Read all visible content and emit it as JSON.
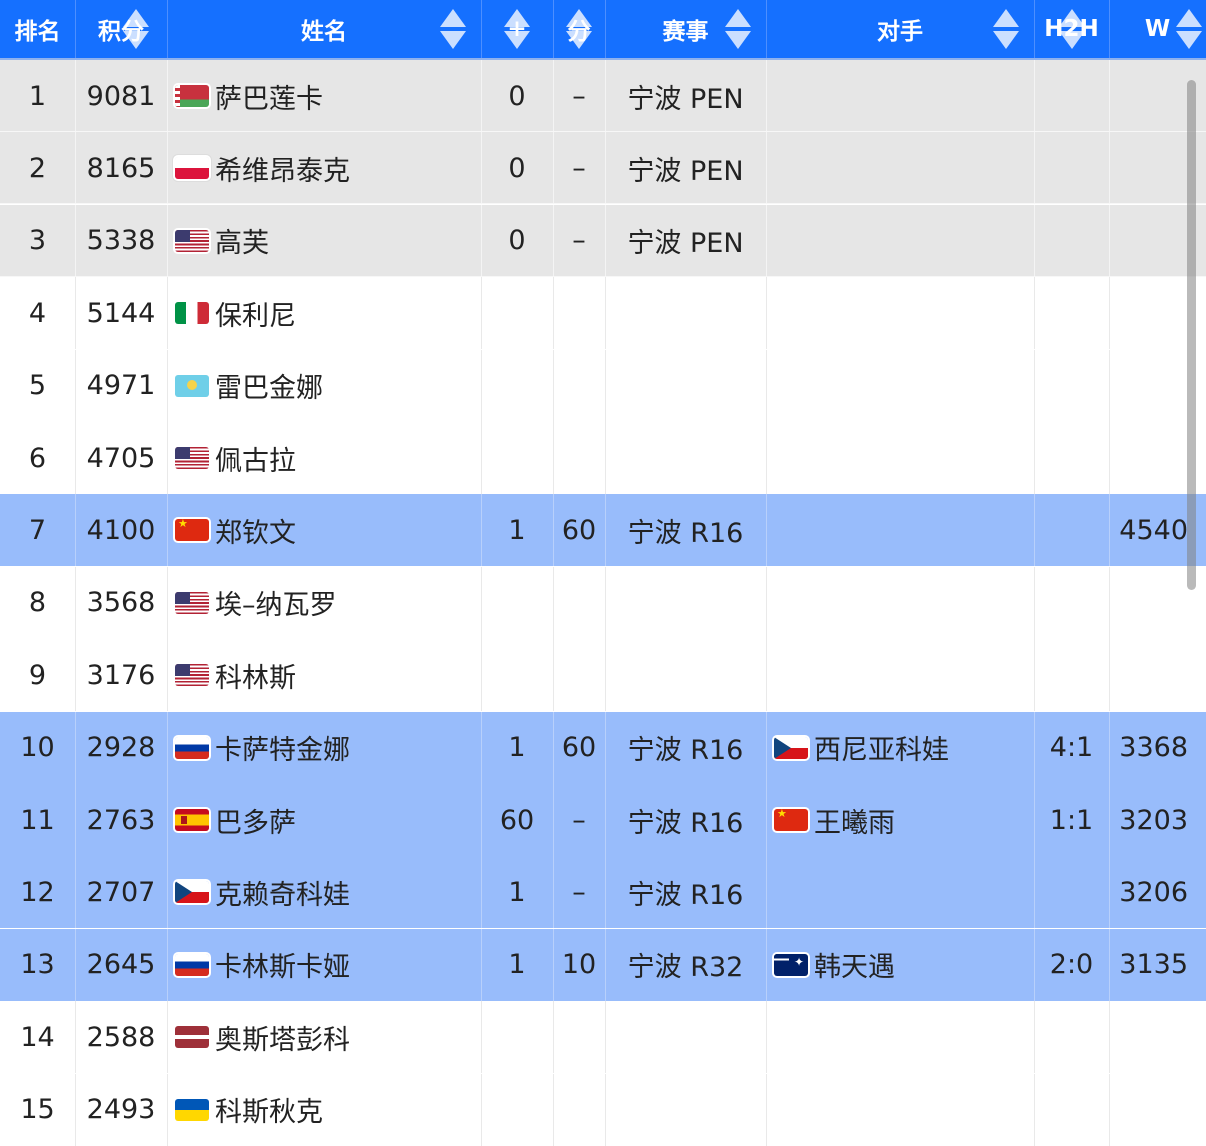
{
  "header": {
    "columns": [
      "排名",
      "积分",
      "姓名",
      "+",
      "分",
      "赛事",
      "对手",
      "H2H",
      "W"
    ]
  },
  "rows": [
    {
      "rank": "1",
      "points": "9081",
      "flag": "by",
      "name": "萨巴莲卡",
      "plus": "0",
      "score": "–",
      "event": "宁波 PEN",
      "opp_flag": "",
      "opponent": "",
      "h2h": "",
      "w": "",
      "style": "gray"
    },
    {
      "rank": "2",
      "points": "8165",
      "flag": "pl",
      "name": "希维昂泰克",
      "plus": "0",
      "score": "–",
      "event": "宁波 PEN",
      "opp_flag": "",
      "opponent": "",
      "h2h": "",
      "w": "",
      "style": "gray"
    },
    {
      "rank": "3",
      "points": "5338",
      "flag": "us",
      "name": "高芙",
      "plus": "0",
      "score": "–",
      "event": "宁波 PEN",
      "opp_flag": "",
      "opponent": "",
      "h2h": "",
      "w": "",
      "style": "gray"
    },
    {
      "rank": "4",
      "points": "5144",
      "flag": "it",
      "name": "保利尼",
      "plus": "",
      "score": "",
      "event": "",
      "opp_flag": "",
      "opponent": "",
      "h2h": "",
      "w": "",
      "style": "white"
    },
    {
      "rank": "5",
      "points": "4971",
      "flag": "kz",
      "name": "雷巴金娜",
      "plus": "",
      "score": "",
      "event": "",
      "opp_flag": "",
      "opponent": "",
      "h2h": "",
      "w": "",
      "style": "white"
    },
    {
      "rank": "6",
      "points": "4705",
      "flag": "us",
      "name": "佩古拉",
      "plus": "",
      "score": "",
      "event": "",
      "opp_flag": "",
      "opponent": "",
      "h2h": "",
      "w": "",
      "style": "white"
    },
    {
      "rank": "7",
      "points": "4100",
      "flag": "cn",
      "name": "郑钦文",
      "plus": "1",
      "score": "60",
      "event": "宁波 R16",
      "opp_flag": "",
      "opponent": "",
      "h2h": "",
      "w": "4540",
      "style": "blue"
    },
    {
      "rank": "8",
      "points": "3568",
      "flag": "us",
      "name": "埃–纳瓦罗",
      "plus": "",
      "score": "",
      "event": "",
      "opp_flag": "",
      "opponent": "",
      "h2h": "",
      "w": "",
      "style": "white"
    },
    {
      "rank": "9",
      "points": "3176",
      "flag": "us",
      "name": "科林斯",
      "plus": "",
      "score": "",
      "event": "",
      "opp_flag": "",
      "opponent": "",
      "h2h": "",
      "w": "",
      "style": "white"
    },
    {
      "rank": "10",
      "points": "2928",
      "flag": "ru",
      "name": "卡萨特金娜",
      "plus": "1",
      "score": "60",
      "event": "宁波 R16",
      "opp_flag": "cz",
      "opponent": "西尼亚科娃",
      "h2h": "4:1",
      "w": "3368",
      "style": "blue"
    },
    {
      "rank": "11",
      "points": "2763",
      "flag": "es",
      "name": "巴多萨",
      "plus": "60",
      "score": "–",
      "event": "宁波 R16",
      "opp_flag": "cn",
      "opponent": "王曦雨",
      "h2h": "1:1",
      "w": "3203",
      "style": "blue"
    },
    {
      "rank": "12",
      "points": "2707",
      "flag": "cz",
      "name": "克赖奇科娃",
      "plus": "1",
      "score": "–",
      "event": "宁波 R16",
      "opp_flag": "",
      "opponent": "",
      "h2h": "",
      "w": "3206",
      "style": "blue"
    },
    {
      "rank": "13",
      "points": "2645",
      "flag": "ru",
      "name": "卡林斯卡娅",
      "plus": "1",
      "score": "10",
      "event": "宁波 R32",
      "opp_flag": "au",
      "opponent": "韩天遇",
      "h2h": "2:0",
      "w": "3135",
      "style": "blue"
    },
    {
      "rank": "14",
      "points": "2588",
      "flag": "lv",
      "name": "奥斯塔彭科",
      "plus": "",
      "score": "",
      "event": "",
      "opp_flag": "",
      "opponent": "",
      "h2h": "",
      "w": "",
      "style": "white"
    },
    {
      "rank": "15",
      "points": "2493",
      "flag": "ua",
      "name": "科斯秋克",
      "plus": "",
      "score": "",
      "event": "",
      "opp_flag": "",
      "opponent": "",
      "h2h": "",
      "w": "",
      "style": "white"
    }
  ]
}
